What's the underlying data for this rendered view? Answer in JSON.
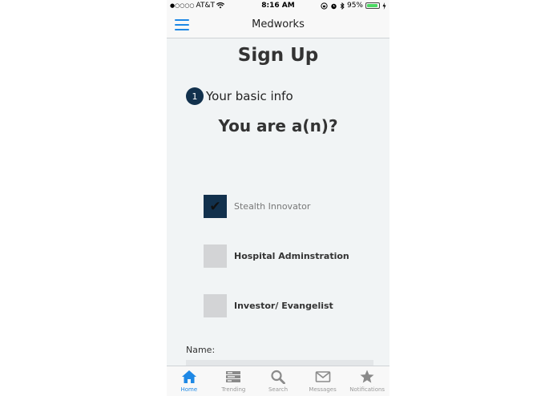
{
  "status_bar": {
    "signal_dots": "●○○○○",
    "carrier": "AT&T",
    "time": "8:16 AM",
    "battery_percent": "95%",
    "battery_level": 0.95
  },
  "nav": {
    "title": "Medworks"
  },
  "page": {
    "title": "Sign Up",
    "step_number": "1",
    "step_label": "Your basic info",
    "question": "You are a(n)?"
  },
  "options": [
    {
      "label": "Stealth Innovator",
      "checked": true
    },
    {
      "label": "Hospital Adminstration",
      "checked": false
    },
    {
      "label": "Investor/ Evangelist",
      "checked": false
    }
  ],
  "form": {
    "name_label": "Name:",
    "name_value": ""
  },
  "tabs": [
    {
      "label": "Home",
      "icon": "home-icon",
      "active": true
    },
    {
      "label": "Trending",
      "icon": "trending-icon",
      "active": false
    },
    {
      "label": "Search",
      "icon": "search-icon",
      "active": false
    },
    {
      "label": "Messages",
      "icon": "envelope-icon",
      "active": false
    },
    {
      "label": "Notifications",
      "icon": "star-icon",
      "active": false
    }
  ],
  "colors": {
    "accent": "#1e88e5",
    "dark_navy": "#12314d",
    "background": "#f1f4f5",
    "checkbox_gray": "#d3d4d6",
    "battery_green": "#4cd964"
  }
}
